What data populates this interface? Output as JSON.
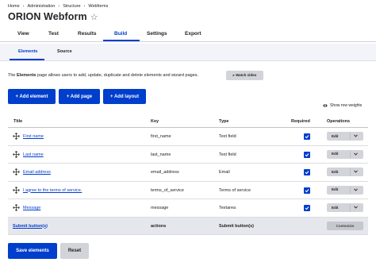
{
  "breadcrumb": [
    "Home",
    "Administration",
    "Structure",
    "Webforms"
  ],
  "page_title": "ORION Webform",
  "primary_tabs": [
    "View",
    "Test",
    "Results",
    "Build",
    "Settings",
    "Export"
  ],
  "active_primary_tab": "Build",
  "secondary_tabs": [
    "Elements",
    "Source"
  ],
  "active_secondary_tab": "Elements",
  "description": {
    "prefix": "The ",
    "bold": "Elements",
    "suffix": " page allows users to add, update, duplicate and delete elements and wizard pages."
  },
  "watch_video_label": "▸ Watch video",
  "buttons": {
    "add_element": "+ Add element",
    "add_page": "+ Add page",
    "add_layout": "+ Add layout",
    "show_row_weights": "Show row weights",
    "save": "Save elements",
    "reset": "Reset"
  },
  "table": {
    "headers": [
      "Title",
      "Key",
      "Type",
      "Required",
      "Operations"
    ],
    "rows": [
      {
        "title": "First name",
        "key": "first_name",
        "type": "Text field",
        "required": true,
        "operation": "Edit"
      },
      {
        "title": "Last name",
        "key": "last_name",
        "type": "Text field",
        "required": true,
        "operation": "Edit"
      },
      {
        "title": "Email address",
        "key": "email_address",
        "type": "Email",
        "required": true,
        "operation": "Edit"
      },
      {
        "title": "I agree to the terms of service.",
        "key": "terms_of_service",
        "type": "Terms of service",
        "required": true,
        "operation": "Edit"
      },
      {
        "title": "Message",
        "key": "message",
        "type": "Textarea",
        "required": true,
        "operation": "Edit"
      }
    ],
    "submit_row": {
      "title": "Submit button(s)",
      "key": "actions",
      "type": "Submit button(s)",
      "operation": "Customize"
    }
  },
  "colors": {
    "accent": "#003ecc",
    "button_gray": "#d3d4d9",
    "submit_row_bg": "#e6e7ec"
  }
}
